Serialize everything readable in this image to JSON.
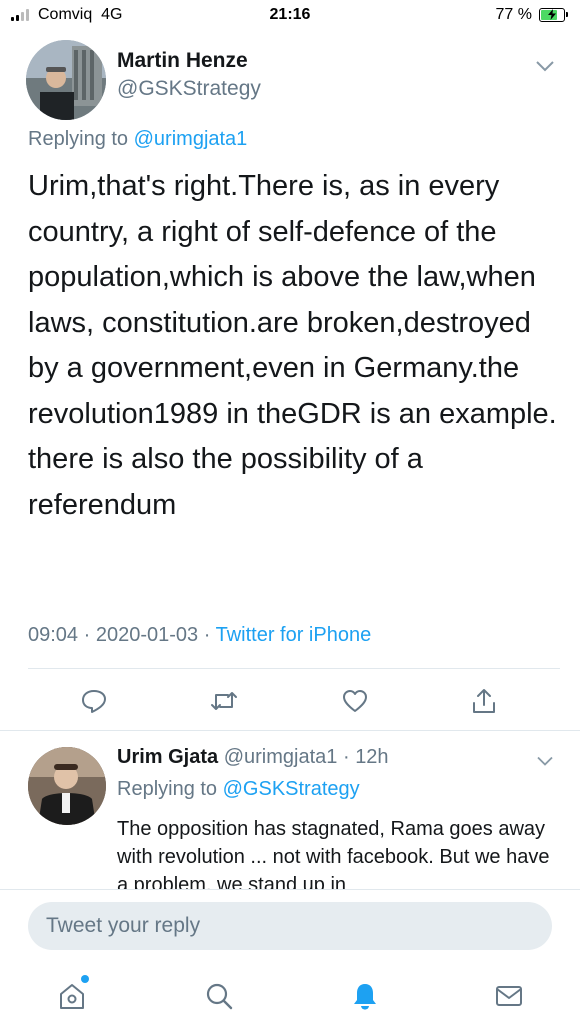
{
  "status_bar": {
    "carrier": "Comviq",
    "network": "4G",
    "time": "21:16",
    "battery_percent": "77 %",
    "battery_level": 0.77
  },
  "main_tweet": {
    "name": "Martin Henze",
    "handle": "@GSKStrategy",
    "replying_prefix": "Replying to ",
    "replying_to": "@urimgjata1",
    "body": "Urim,that's right.There is, as in every country, a right of self-defence of the population,which is above the law,when laws, constitution.are broken,destroyed by a government,even in Germany.the revolution1989 in theGDR is an example. there is also the possibility of a referendum",
    "time": "09:04",
    "date": "2020-01-03",
    "source": "Twitter for iPhone"
  },
  "reply_tweet": {
    "name": "Urim Gjata",
    "handle": "@urimgjata1",
    "age": "12h",
    "replying_prefix": "Replying to ",
    "replying_to": "@GSKStrategy",
    "body": "The opposition has stagnated, Rama goes away with revolution ... not with facebook. But we have a problem, we stand up in"
  },
  "compose": {
    "placeholder": "Tweet your reply"
  },
  "icons": {
    "reply": "reply-icon",
    "retweet": "retweet-icon",
    "like": "heart-icon",
    "share": "share-icon",
    "home": "home-icon",
    "search": "search-icon",
    "notifications": "bell-icon",
    "messages": "mail-icon"
  },
  "colors": {
    "accent": "#1da1f2",
    "secondary_text": "#657786",
    "battery": "#4cd964"
  }
}
